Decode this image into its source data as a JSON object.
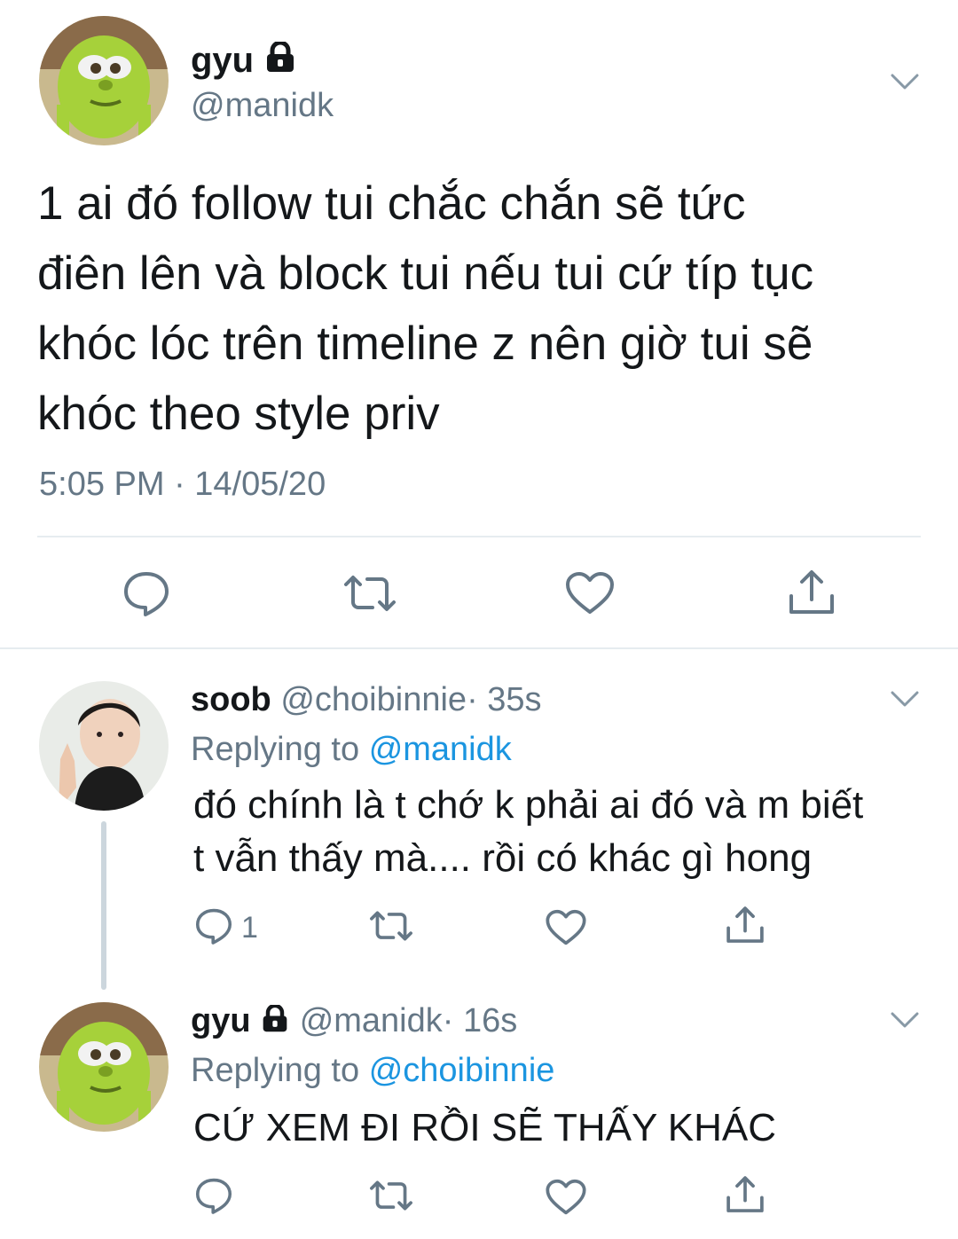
{
  "main_tweet": {
    "name": "gyu",
    "handle": "@manidk",
    "text_lines": [
      "1 ai đó follow tui chắc chắn sẽ tức",
      "điên lên và block tui nếu tui cứ típ tục",
      "khóc lóc trên timeline z nên giờ tui sẽ",
      "khóc theo style priv"
    ],
    "timestamp": "5:05 PM · 14/05/20",
    "actions": [
      "reply-icon",
      "retweet-icon",
      "like-icon",
      "share-icon"
    ]
  },
  "replies": [
    {
      "name": "soob",
      "handle": "@choibinnie",
      "time": "· 35s",
      "replying_prefix": "Replying to",
      "replying_to": "@manidk",
      "text_lines": [
        "đó chính là t chớ k phải ai đó và m biết",
        "t vẫn thấy mà.... rồi có khác gì hong"
      ],
      "reply_count": "1"
    },
    {
      "name": "gyu",
      "handle": "@manidk",
      "time": "· 16s",
      "replying_prefix": "Replying to",
      "replying_to": "@choibinnie",
      "text_lines": [
        "CỨ XEM ĐI RỒI SẼ THẤY KHÁC"
      ],
      "reply_count": ""
    }
  ],
  "colors": {
    "text": "#14171a",
    "muted": "#657786",
    "link": "#1b95e0",
    "divider": "#e6ecf0",
    "thread_line": "#ccd6dd",
    "avatar_mike": "#9ccc2f"
  }
}
